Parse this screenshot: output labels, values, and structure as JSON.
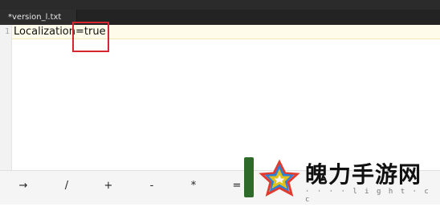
{
  "tab": {
    "title": "*version_l.txt"
  },
  "editor": {
    "line_number": "1",
    "line_text": "Localization=true"
  },
  "keyboard": {
    "keys": [
      "→",
      "/",
      "+",
      "-",
      "*",
      "="
    ]
  },
  "watermark": {
    "title": "魄力手游网",
    "subtitle": "· · · · l i g h t · c c"
  },
  "colors": {
    "highlight_box": "#d7262f",
    "current_line": "#fffbea",
    "tab_bar": "#232323"
  }
}
